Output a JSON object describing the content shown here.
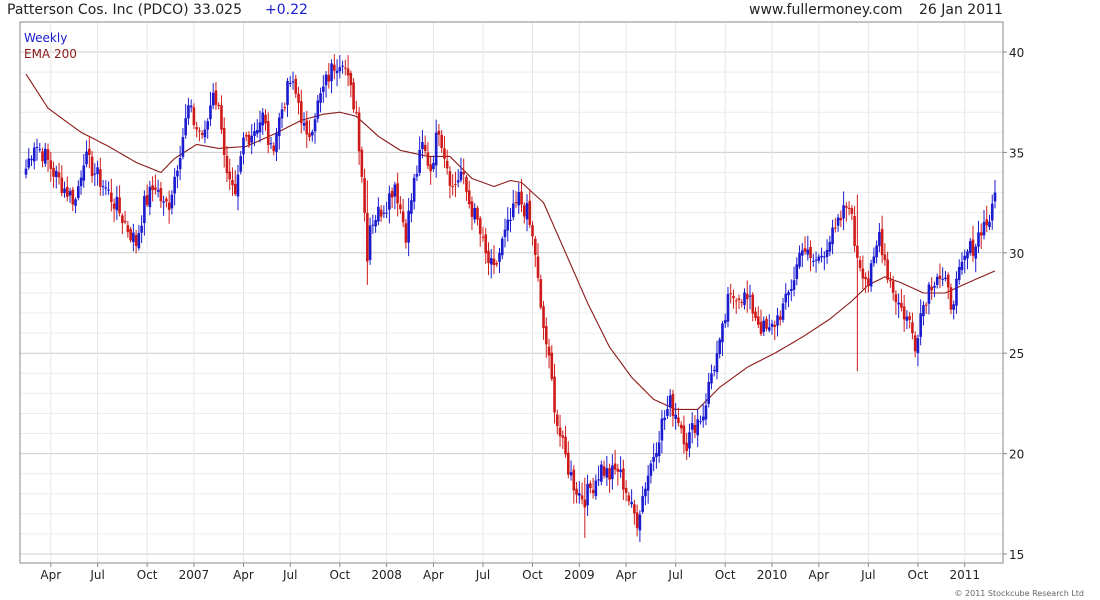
{
  "header": {
    "title": "Patterson Cos. Inc (PDCO) 33.025",
    "change": "+0.22",
    "site": "www.fullermoney.com",
    "date": "26 Jan 2011"
  },
  "credit": "© 2011 Stockcube Research Ltd",
  "colors": {
    "up": "#1a1acf",
    "down": "#cf1a1a",
    "ema": "#8b1a1a",
    "grid": "#dddddd"
  },
  "chart_data": {
    "type": "candlestick",
    "title": "Patterson Cos. Inc (PDCO) 33.025 +0.22",
    "legend": [
      {
        "name": "Weekly",
        "color": "#1a1acf"
      },
      {
        "name": "EMA 200",
        "color": "#8b1a1a"
      }
    ],
    "legend_position": "top-left",
    "grid": true,
    "ylim": [
      15,
      40.5
    ],
    "y_ticks": [
      15,
      20,
      25,
      30,
      35,
      40
    ],
    "x_ticks": [
      "Apr",
      "Jul",
      "Oct",
      "2007",
      "Apr",
      "Jul",
      "Oct",
      "2008",
      "Apr",
      "Jul",
      "Oct",
      "2009",
      "Apr",
      "Jul",
      "Oct",
      "2010",
      "Apr",
      "Jul",
      "Oct",
      "2011"
    ],
    "close_anchors": [
      [
        0,
        34.2
      ],
      [
        3,
        35.5
      ],
      [
        7,
        34.8
      ],
      [
        10,
        34.0
      ],
      [
        14,
        33.2
      ],
      [
        18,
        32.6
      ],
      [
        21,
        34.8
      ],
      [
        25,
        34.0
      ],
      [
        29,
        33.2
      ],
      [
        33,
        32.3
      ],
      [
        37,
        31.2
      ],
      [
        40,
        30.5
      ],
      [
        43,
        32.4
      ],
      [
        47,
        33.4
      ],
      [
        50,
        32.3
      ],
      [
        52,
        32.5
      ],
      [
        55,
        34.5
      ],
      [
        59,
        37.2
      ],
      [
        62,
        36.2
      ],
      [
        65,
        35.8
      ],
      [
        68,
        38.2
      ],
      [
        71,
        36.5
      ],
      [
        73,
        33.7
      ],
      [
        76,
        32.5
      ],
      [
        79,
        35.6
      ],
      [
        82,
        36.0
      ],
      [
        86,
        36.8
      ],
      [
        89,
        35.0
      ],
      [
        93,
        37.2
      ],
      [
        96,
        38.5
      ],
      [
        99,
        37.5
      ],
      [
        102,
        35.5
      ],
      [
        105,
        37.0
      ],
      [
        109,
        38.5
      ],
      [
        112,
        39.4
      ],
      [
        115,
        39.8
      ],
      [
        117,
        38.5
      ],
      [
        120,
        37.0
      ],
      [
        122,
        34.0
      ],
      [
        124,
        30.0
      ],
      [
        125,
        31.5
      ],
      [
        128,
        32.0
      ],
      [
        131,
        32.5
      ],
      [
        134,
        33.5
      ],
      [
        136,
        32.2
      ],
      [
        138,
        31.0
      ],
      [
        141,
        33.5
      ],
      [
        144,
        35.3
      ],
      [
        147,
        34.2
      ],
      [
        150,
        36.3
      ],
      [
        152,
        35.0
      ],
      [
        155,
        33.2
      ],
      [
        158,
        34.0
      ],
      [
        161,
        32.5
      ],
      [
        164,
        31.5
      ],
      [
        167,
        29.8
      ],
      [
        170,
        29.0
      ],
      [
        173,
        30.5
      ],
      [
        176,
        31.6
      ],
      [
        179,
        32.7
      ],
      [
        182,
        32.0
      ],
      [
        185,
        30.0
      ],
      [
        187,
        27.0
      ],
      [
        189,
        25.5
      ],
      [
        191,
        23.5
      ],
      [
        193,
        21.5
      ],
      [
        195,
        20.3
      ],
      [
        197,
        19.3
      ],
      [
        199,
        18.5
      ],
      [
        201,
        18.0
      ],
      [
        203,
        17.8
      ],
      [
        206,
        18.5
      ],
      [
        209,
        19.3
      ],
      [
        212,
        18.9
      ],
      [
        215,
        19.2
      ],
      [
        218,
        18.2
      ],
      [
        220,
        17.2
      ],
      [
        222,
        16.7
      ],
      [
        225,
        18.5
      ],
      [
        228,
        20.0
      ],
      [
        231,
        21.5
      ],
      [
        234,
        22.5
      ],
      [
        237,
        21.8
      ],
      [
        240,
        20.5
      ],
      [
        243,
        21.5
      ],
      [
        246,
        22.0
      ],
      [
        249,
        24.0
      ],
      [
        252,
        25.3
      ],
      [
        255,
        27.5
      ],
      [
        258,
        28.0
      ],
      [
        261,
        27.8
      ],
      [
        264,
        27.2
      ],
      [
        267,
        26.3
      ],
      [
        270,
        26.0
      ],
      [
        273,
        26.8
      ],
      [
        276,
        27.5
      ],
      [
        279,
        28.8
      ],
      [
        282,
        30.5
      ],
      [
        285,
        29.5
      ],
      [
        288,
        29.7
      ],
      [
        291,
        30.5
      ],
      [
        294,
        31.0
      ],
      [
        297,
        32.0
      ],
      [
        299,
        32.6
      ],
      [
        301,
        30.5
      ],
      [
        303,
        29.5
      ],
      [
        306,
        28.5
      ],
      [
        308,
        29.5
      ],
      [
        310,
        31.0
      ],
      [
        313,
        29.0
      ],
      [
        316,
        27.8
      ],
      [
        318,
        27.2
      ],
      [
        321,
        26.5
      ],
      [
        323,
        25.5
      ],
      [
        325,
        27.0
      ],
      [
        328,
        28.3
      ],
      [
        331,
        29.0
      ],
      [
        334,
        28.3
      ],
      [
        336,
        27.5
      ],
      [
        339,
        28.8
      ],
      [
        342,
        30.0
      ],
      [
        345,
        30.5
      ],
      [
        347,
        31.3
      ],
      [
        349,
        31.5
      ],
      [
        351,
        32.0
      ],
      [
        352,
        33.0
      ]
    ],
    "ema_anchors": [
      [
        0,
        38.9
      ],
      [
        8,
        37.2
      ],
      [
        20,
        36.0
      ],
      [
        30,
        35.3
      ],
      [
        40,
        34.5
      ],
      [
        49,
        34.0
      ],
      [
        54,
        34.7
      ],
      [
        62,
        35.4
      ],
      [
        70,
        35.2
      ],
      [
        80,
        35.3
      ],
      [
        90,
        35.9
      ],
      [
        100,
        36.6
      ],
      [
        108,
        36.9
      ],
      [
        114,
        37.0
      ],
      [
        120,
        36.8
      ],
      [
        128,
        35.8
      ],
      [
        136,
        35.1
      ],
      [
        146,
        34.8
      ],
      [
        154,
        34.8
      ],
      [
        162,
        33.7
      ],
      [
        170,
        33.3
      ],
      [
        176,
        33.6
      ],
      [
        180,
        33.5
      ],
      [
        188,
        32.5
      ],
      [
        196,
        30.0
      ],
      [
        204,
        27.5
      ],
      [
        212,
        25.3
      ],
      [
        220,
        23.8
      ],
      [
        228,
        22.7
      ],
      [
        236,
        22.2
      ],
      [
        244,
        22.2
      ],
      [
        252,
        23.3
      ],
      [
        262,
        24.3
      ],
      [
        272,
        25.0
      ],
      [
        282,
        25.8
      ],
      [
        292,
        26.7
      ],
      [
        300,
        27.6
      ],
      [
        306,
        28.4
      ],
      [
        312,
        28.8
      ],
      [
        318,
        28.5
      ],
      [
        326,
        28.0
      ],
      [
        334,
        28.0
      ],
      [
        342,
        28.5
      ],
      [
        352,
        29.1
      ]
    ],
    "week_count": 353,
    "ticks_weeks": [
      9,
      26,
      44,
      61,
      79,
      96,
      114,
      131,
      148,
      166,
      184,
      201,
      218,
      236,
      254,
      271,
      288,
      306,
      324,
      341
    ]
  }
}
